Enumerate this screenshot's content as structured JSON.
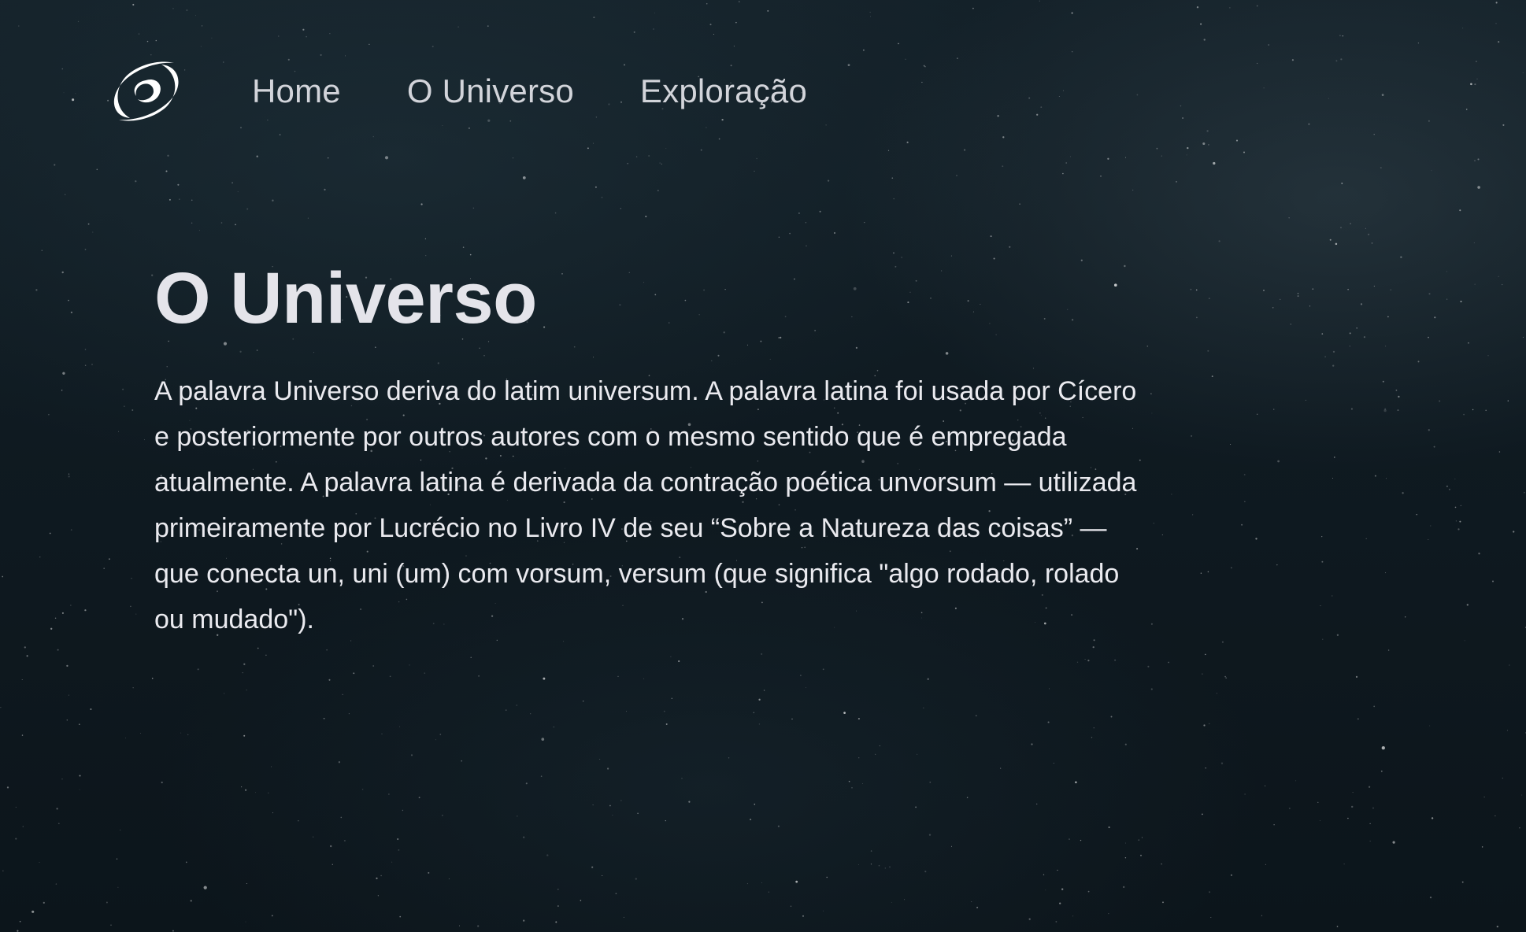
{
  "theme": {
    "background": "#0d161c",
    "text": "#e6e6ea",
    "nav_text": "#d2d4da"
  },
  "header": {
    "logo_icon": "galaxy-swirl-icon",
    "nav": [
      {
        "label": "Home"
      },
      {
        "label": "O Universo"
      },
      {
        "label": "Exploração"
      }
    ]
  },
  "main": {
    "title": "O Universo",
    "body": "A palavra Universo deriva do latim universum. A palavra latina foi usada por Cícero e posteriormente por outros autores com o mesmo sentido que é empregada atualmente. A palavra latina é derivada da contração poética unvorsum — utilizada primeiramente por Lucrécio no Livro IV de seu “Sobre a Natureza das coisas” — que conecta un, uni (um) com vorsum, versum (que significa \"algo rodado, rolado ou mudado\")."
  }
}
